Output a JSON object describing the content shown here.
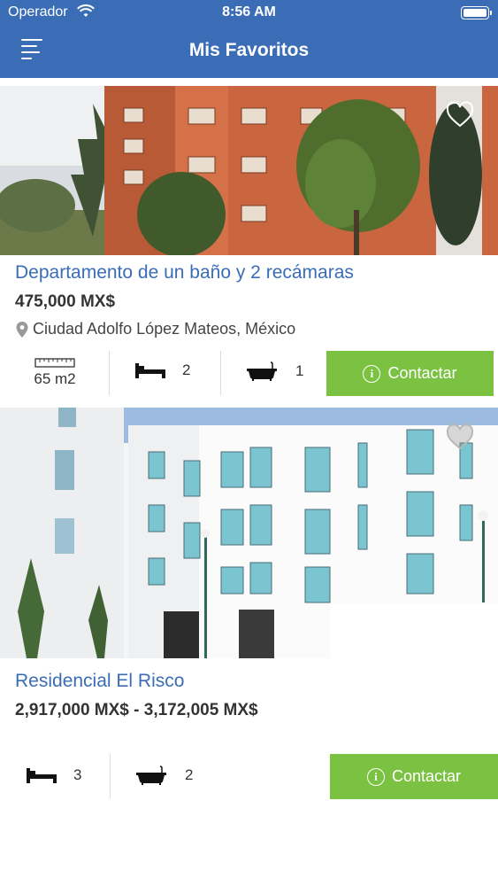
{
  "status_bar": {
    "carrier": "Operador",
    "time": "8:56 AM"
  },
  "header": {
    "title": "Mis Favoritos"
  },
  "listings": [
    {
      "title": "Departamento de un baño y 2 recámaras",
      "price": "475,000 MX$",
      "location": "Ciudad Adolfo López Mateos, México",
      "area": "65 m2",
      "bedrooms": "2",
      "bathrooms": "1",
      "contact_label": "Contactar"
    },
    {
      "title": "Residencial El Risco",
      "price": "2,917,000 MX$ - 3,172,005 MX$",
      "bedrooms": "3",
      "bathrooms": "2",
      "contact_label": "Contactar"
    }
  ],
  "icons": {
    "menu": "menu-icon",
    "favorite": "heart-icon",
    "location": "location-pin-icon",
    "area": "ruler-icon",
    "bed": "bed-icon",
    "bath": "bathtub-icon",
    "info": "info-icon"
  },
  "colors": {
    "header": "#3a6db5",
    "title_link": "#3a6db5",
    "contact_button": "#7cc242"
  }
}
